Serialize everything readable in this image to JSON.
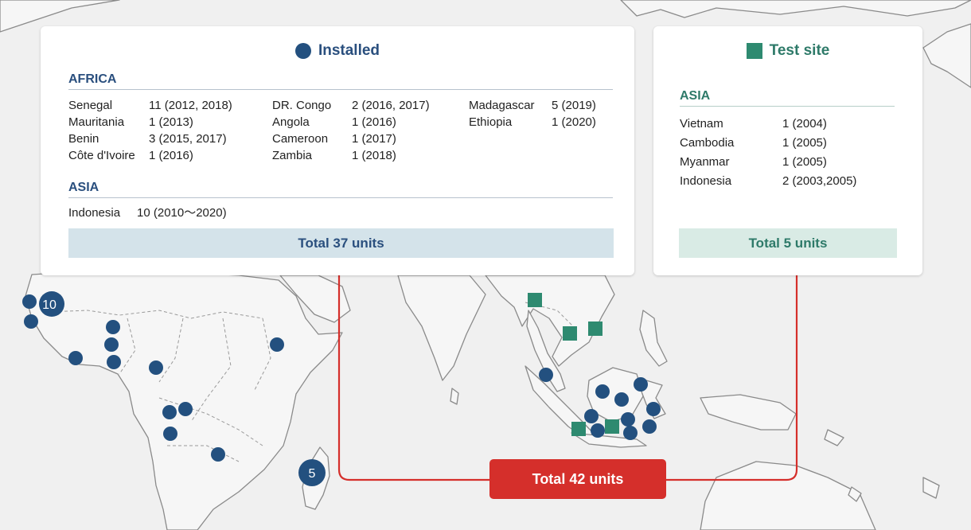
{
  "colors": {
    "installed": "#23507f",
    "test_site": "#2e8a70",
    "highlight": "#d52f2b"
  },
  "installed": {
    "heading": "Installed",
    "legend_icon": "circle-marker",
    "africa": {
      "title": "AFRICA",
      "columns": [
        [
          {
            "country": "Senegal",
            "count": "11 (2012, 2018)"
          },
          {
            "country": "Mauritania",
            "count": "1 (2013)"
          },
          {
            "country": "Benin",
            "count": "3 (2015, 2017)"
          },
          {
            "country": "Côte d'Ivoire",
            "count": "1 (2016)"
          }
        ],
        [
          {
            "country": "DR. Congo",
            "count": "2 (2016, 2017)"
          },
          {
            "country": "Angola",
            "count": "1 (2016)"
          },
          {
            "country": "Cameroon",
            "count": "1 (2017)"
          },
          {
            "country": "Zambia",
            "count": "1 (2018)"
          }
        ],
        [
          {
            "country": "Madagascar",
            "count": "5 (2019)"
          },
          {
            "country": "Ethiopia",
            "count": "1 (2020)"
          }
        ]
      ]
    },
    "asia": {
      "title": "ASIA",
      "rows": [
        {
          "country": "Indonesia",
          "count": "10 (2010～2020)"
        }
      ]
    },
    "total": "Total 37 units"
  },
  "test_site": {
    "heading": "Test site",
    "legend_icon": "square-marker",
    "asia": {
      "title": "ASIA",
      "rows": [
        {
          "country": "Vietnam",
          "count": "1 (2004)"
        },
        {
          "country": "Cambodia",
          "count": "1 (2005)"
        },
        {
          "country": "Myanmar",
          "count": "1 (2005)"
        },
        {
          "country": "Indonesia",
          "count": "2 (2003,2005)"
        }
      ]
    },
    "total": "Total 5 units"
  },
  "map": {
    "marker_labels": {
      "senegal": "10",
      "madagascar": "5"
    },
    "grand_total": "Total 42 units"
  }
}
